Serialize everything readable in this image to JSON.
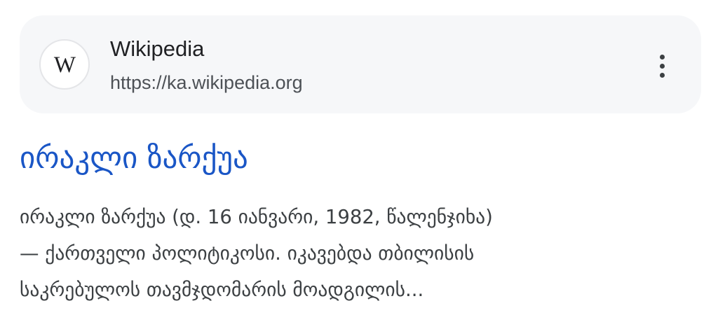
{
  "source": {
    "favicon_letter": "W",
    "site_name": "Wikipedia",
    "url": "https://ka.wikipedia.org",
    "more_icon": "more-vert-icon"
  },
  "result": {
    "title": "ირაკლი ზარქუა",
    "snippet_lines": [
      "ირაკლი ზარქუა (დ. 16 იანვარი, 1982, წალენჯიხა)",
      "— ქართველი პოლიტიკოსი. იკავებდა თბილისის",
      "საკრებულოს თავმჯდომარის მოადგილის..."
    ]
  },
  "colors": {
    "title_link": "#1a56c6",
    "card_background": "#f6f7f9",
    "snippet_text": "#3c4043"
  }
}
